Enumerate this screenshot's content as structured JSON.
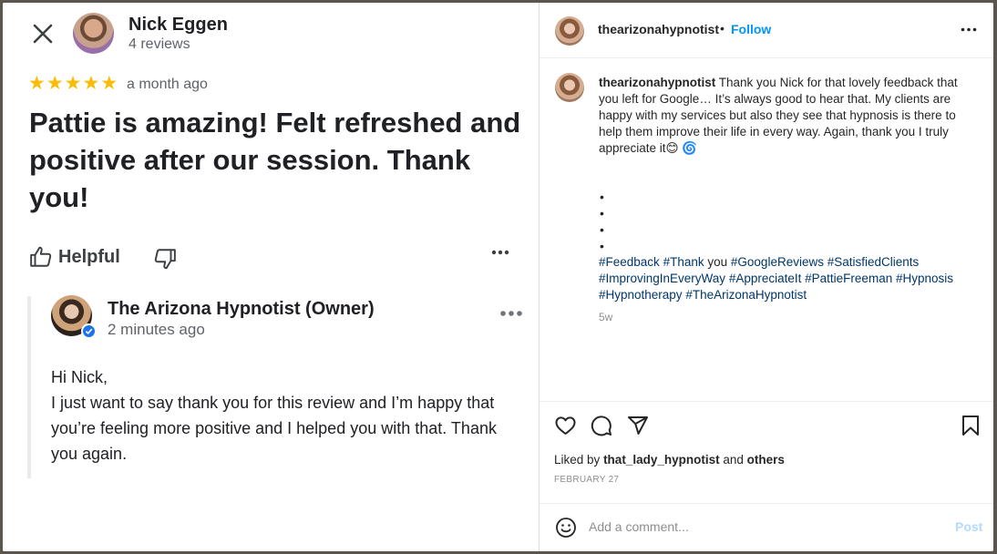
{
  "review": {
    "reviewer_name": "Nick Eggen",
    "reviewer_reviews": "4 reviews",
    "rating": 5,
    "time": "a month ago",
    "text": "Pattie is amazing!  Felt refreshed and positive after our session. Thank you!",
    "helpful_label": "Helpful",
    "owner": {
      "name": "The Arizona Hypnotist (Owner)",
      "time": "2 minutes ago",
      "reply_lines": [
        "Hi Nick,",
        "I just want to say thank you for this review and I’m happy that you’re feeling more positive and I helped you with that. Thank you again."
      ]
    }
  },
  "instagram": {
    "handle": "thearizonahypnotist",
    "separator": "•",
    "follow_label": "Follow",
    "caption_text": "Thank you Nick for that lovely feedback that you left for Google… It’s always good to hear that. My clients are happy with my services but also they see that hypnosis is there to help them improve their life in every way. Again, thank you I truly appreciate it",
    "caption_emojis": "😊 🌀",
    "dots": [
      "•",
      "•",
      "•",
      "•"
    ],
    "hashtags": [
      "#Feedback",
      "#Thank",
      "you",
      "#GoogleReviews",
      "#SatisfiedClients",
      "#ImprovingInEveryWay",
      "#AppreciateIt",
      "#PattieFreeman",
      "#Hypnosis",
      "#Hypnotherapy",
      "#TheArizonaHypnotist"
    ],
    "age": "5w",
    "liked_by_prefix": "Liked by",
    "liked_by_user": "that_lady_hypnotist",
    "liked_by_and": "and",
    "liked_by_others": "others",
    "date": "FEBRUARY 27",
    "comment_placeholder": "Add a comment...",
    "post_label": "Post"
  },
  "colors": {
    "star": "#fbbc04",
    "ig_link": "#0095f6",
    "hashtag": "#00376b",
    "verified": "#1a73e8"
  }
}
